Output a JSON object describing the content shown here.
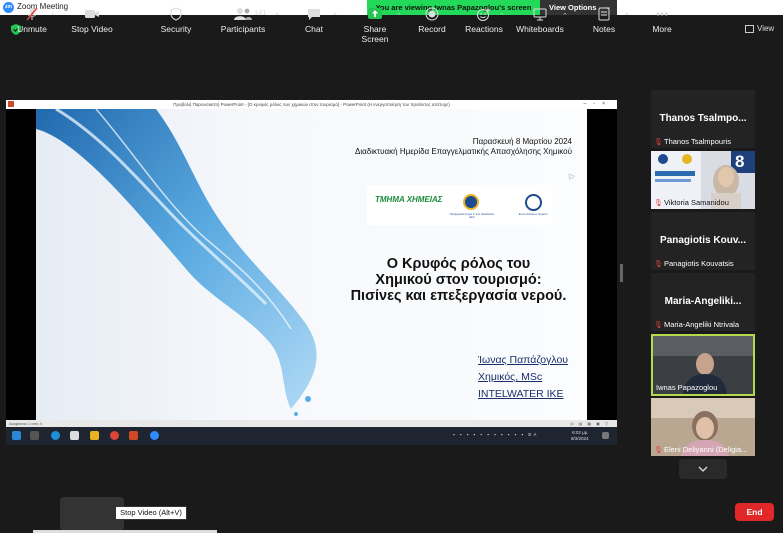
{
  "app": {
    "title": "Zoom Meeting",
    "logo_text": "zm"
  },
  "share_banner": {
    "text": "You are viewing Iwnas Papazoglou's screen",
    "options_label": "View Options"
  },
  "view_button": {
    "label": "View"
  },
  "shared_window": {
    "title": "Προβολή Παρουσιαστή PowerPoint - [Ο κρυφός ρόλος των χημικών στον τουρισμό] - PowerPoint (Η ενεργοποίηση του προϊόντος απέτυχε)",
    "status_left": "Διαφάνεια 1 από 4",
    "taskbar_tray": "EA",
    "clock_time": "6:02 μμ",
    "clock_date": "8/3/2024"
  },
  "slide": {
    "date_line": "Παρασκευή 8 Μαρτίου 2024",
    "event_line": "Διαδικτυακή Ημερίδα Επαγγελματικής Απασχόλησης Χημικού",
    "logo_dept": "ΤΜΗΜΑ ΧΗΜΕΙΑΣ",
    "logo_seal1_caption": "Περιφερειακό Τμήμα Κ. & Δ. Μακεδονίας ΕΕΧ",
    "logo_seal2_caption": "Ένωση Ελλήνων Χημικών",
    "title_lines": [
      "Ο Κρυφός ρόλος του",
      "Χημικού στον τουρισμό:",
      "Πισίνες και επεξεργασία νερού."
    ],
    "author_lines": [
      "Ίωνας Παπάζογλου",
      "Χημικός, MSc",
      "INTELWATER IKE"
    ]
  },
  "participants_gallery": [
    {
      "display_name": "Thanos Tsalmpo...",
      "label": "Thanos Tsalmpouris",
      "type": "name"
    },
    {
      "label": "Viktoria Samanidou",
      "type": "video",
      "badge": "8"
    },
    {
      "display_name": "Panagiotis Kouv...",
      "label": "Panagiotis Kouvatsis",
      "type": "name"
    },
    {
      "display_name": "Maria-Angeliki...",
      "label": "Maria-Angeliki Ntrivala",
      "type": "name"
    },
    {
      "label": "Iwnas Papazoglou",
      "type": "video",
      "active": true
    },
    {
      "label": "Eleni Deliyanni (Deligia...",
      "type": "video"
    }
  ],
  "toolbar": {
    "unmute": "Unmute",
    "stop_video": "Stop Video",
    "security": "Security",
    "participants": "Participants",
    "participants_count": "141",
    "chat": "Chat",
    "share_screen": "Share Screen",
    "record": "Record",
    "reactions": "Reactions",
    "whiteboards": "Whiteboards",
    "notes": "Notes",
    "more": "More",
    "end": "End",
    "tooltip": "Stop Video (Alt+V)"
  },
  "colors": {
    "share_green": "#23d959",
    "active_border": "#b4d94a",
    "end_red": "#e02828",
    "share_icon": "#23c552"
  }
}
